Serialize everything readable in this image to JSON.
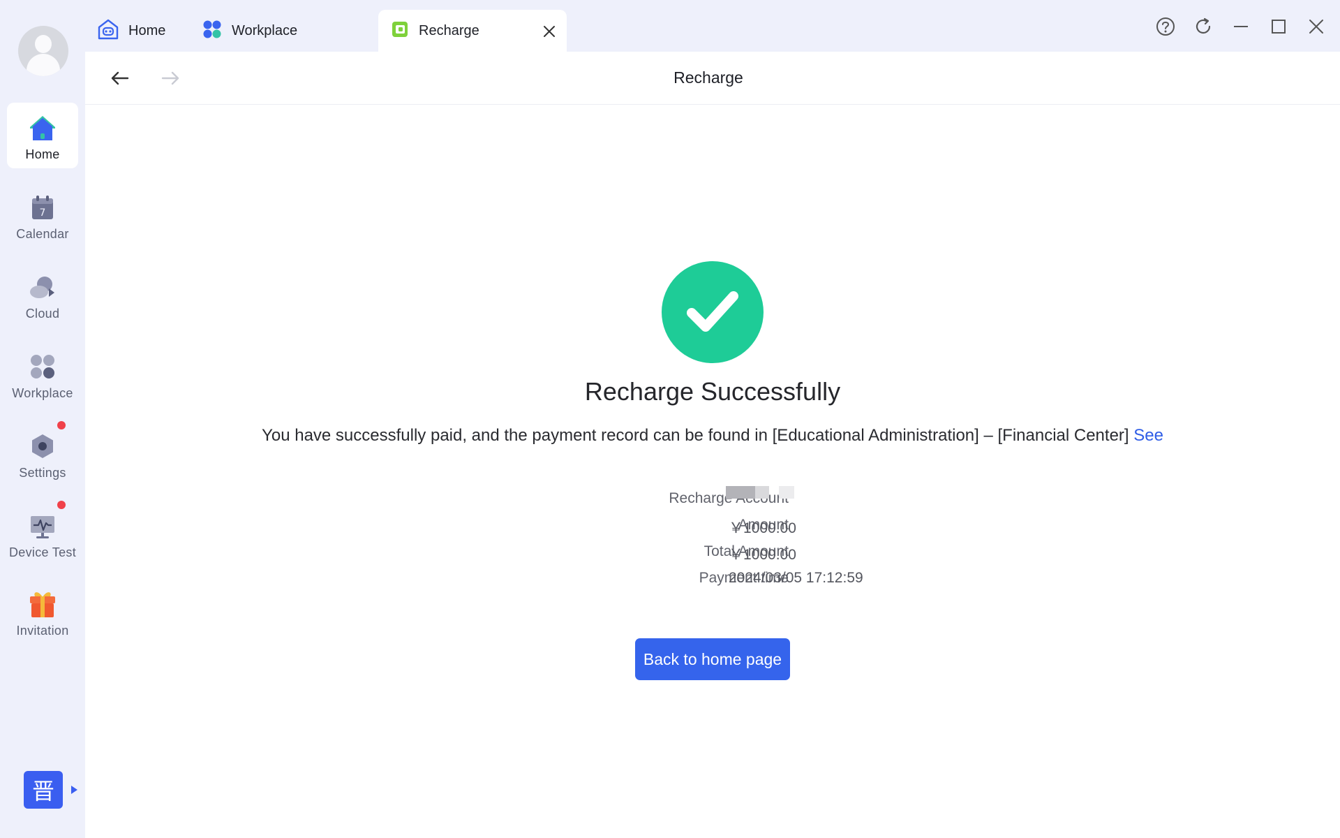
{
  "sidebar": {
    "items": [
      {
        "label": "Home",
        "icon": "home-icon",
        "active": true
      },
      {
        "label": "Calendar",
        "icon": "calendar-icon",
        "calendar_day": "7"
      },
      {
        "label": "Cloud",
        "icon": "cloud-icon"
      },
      {
        "label": "Workplace",
        "icon": "apps-grid-icon"
      },
      {
        "label": "Settings",
        "icon": "settings-icon",
        "has_badge": true
      },
      {
        "label": "Device Test",
        "icon": "monitor-pulse-icon",
        "has_badge": true
      },
      {
        "label": "Invitation",
        "icon": "gift-icon"
      }
    ],
    "brand_glyph": "晋"
  },
  "tabs": [
    {
      "label": "Home",
      "icon": "home-robot-icon"
    },
    {
      "label": "Workplace",
      "icon": "apps-grid-icon"
    },
    {
      "label": "Recharge",
      "icon": "wallet-icon",
      "active": true,
      "closable": true
    }
  ],
  "window_controls": [
    "help-icon",
    "refresh-icon",
    "minimize-icon",
    "maximize-icon",
    "close-icon"
  ],
  "page": {
    "title": "Recharge",
    "result": {
      "title": "Recharge Successfully",
      "description": "You have successfully paid, and the payment record can be found in [Educational Administration] – [Financial Center]",
      "link": "See"
    },
    "details": [
      {
        "label": "Recharge Account",
        "value": ""
      },
      {
        "label": "Amount",
        "value": "￥1000.00"
      },
      {
        "label": "Total Amount",
        "value": "￥1000.00"
      },
      {
        "label": "Payment time",
        "value": "2024/03/05 17:12:59"
      }
    ],
    "back_button": "Back to home page"
  },
  "colors": {
    "accent": "#3564ec",
    "success": "#1ecc97",
    "badge": "#f0414a",
    "link": "#2f5de6"
  }
}
